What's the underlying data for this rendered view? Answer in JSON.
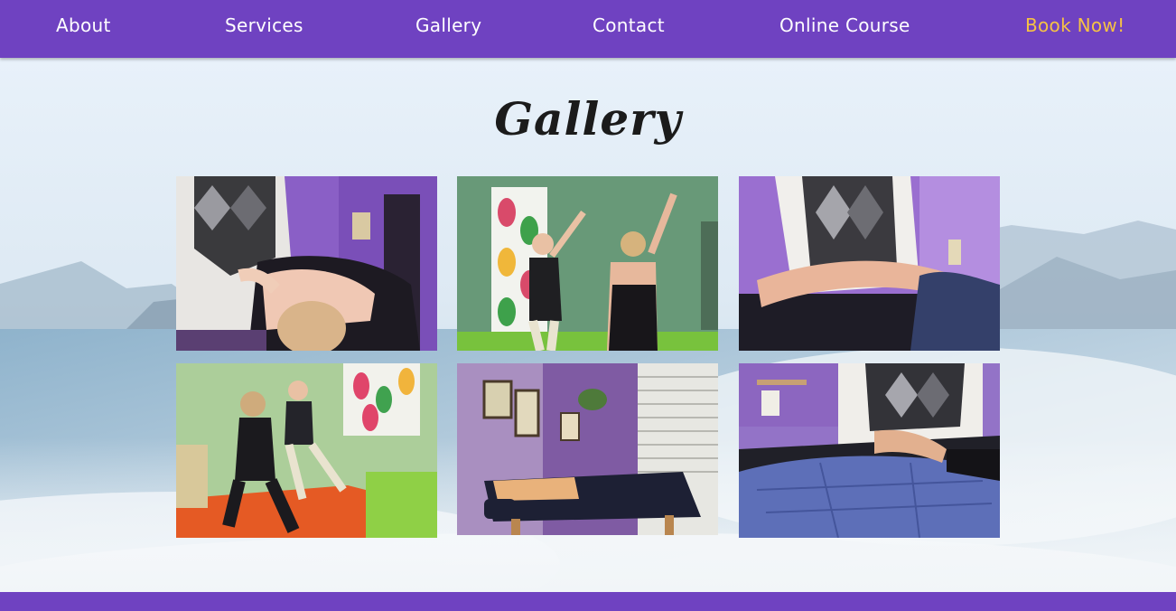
{
  "nav": {
    "about": "About",
    "services": "Services",
    "gallery": "Gallery",
    "contact": "Contact",
    "online_course": "Online Course",
    "book_now": "Book Now!"
  },
  "colors": {
    "nav_bg": "#6f42c1",
    "nav_text": "#ffffff",
    "book_now_text": "#f6c244",
    "title_text": "#1b1b1b"
  },
  "page": {
    "title": "Gallery"
  },
  "gallery": {
    "images": [
      "massage-back-treatment-photo",
      "stretching-arms-raised-photo",
      "arm-therapy-photo",
      "movement-exercise-photo",
      "treatment-room-table-photo",
      "foot-therapy-photo"
    ]
  }
}
